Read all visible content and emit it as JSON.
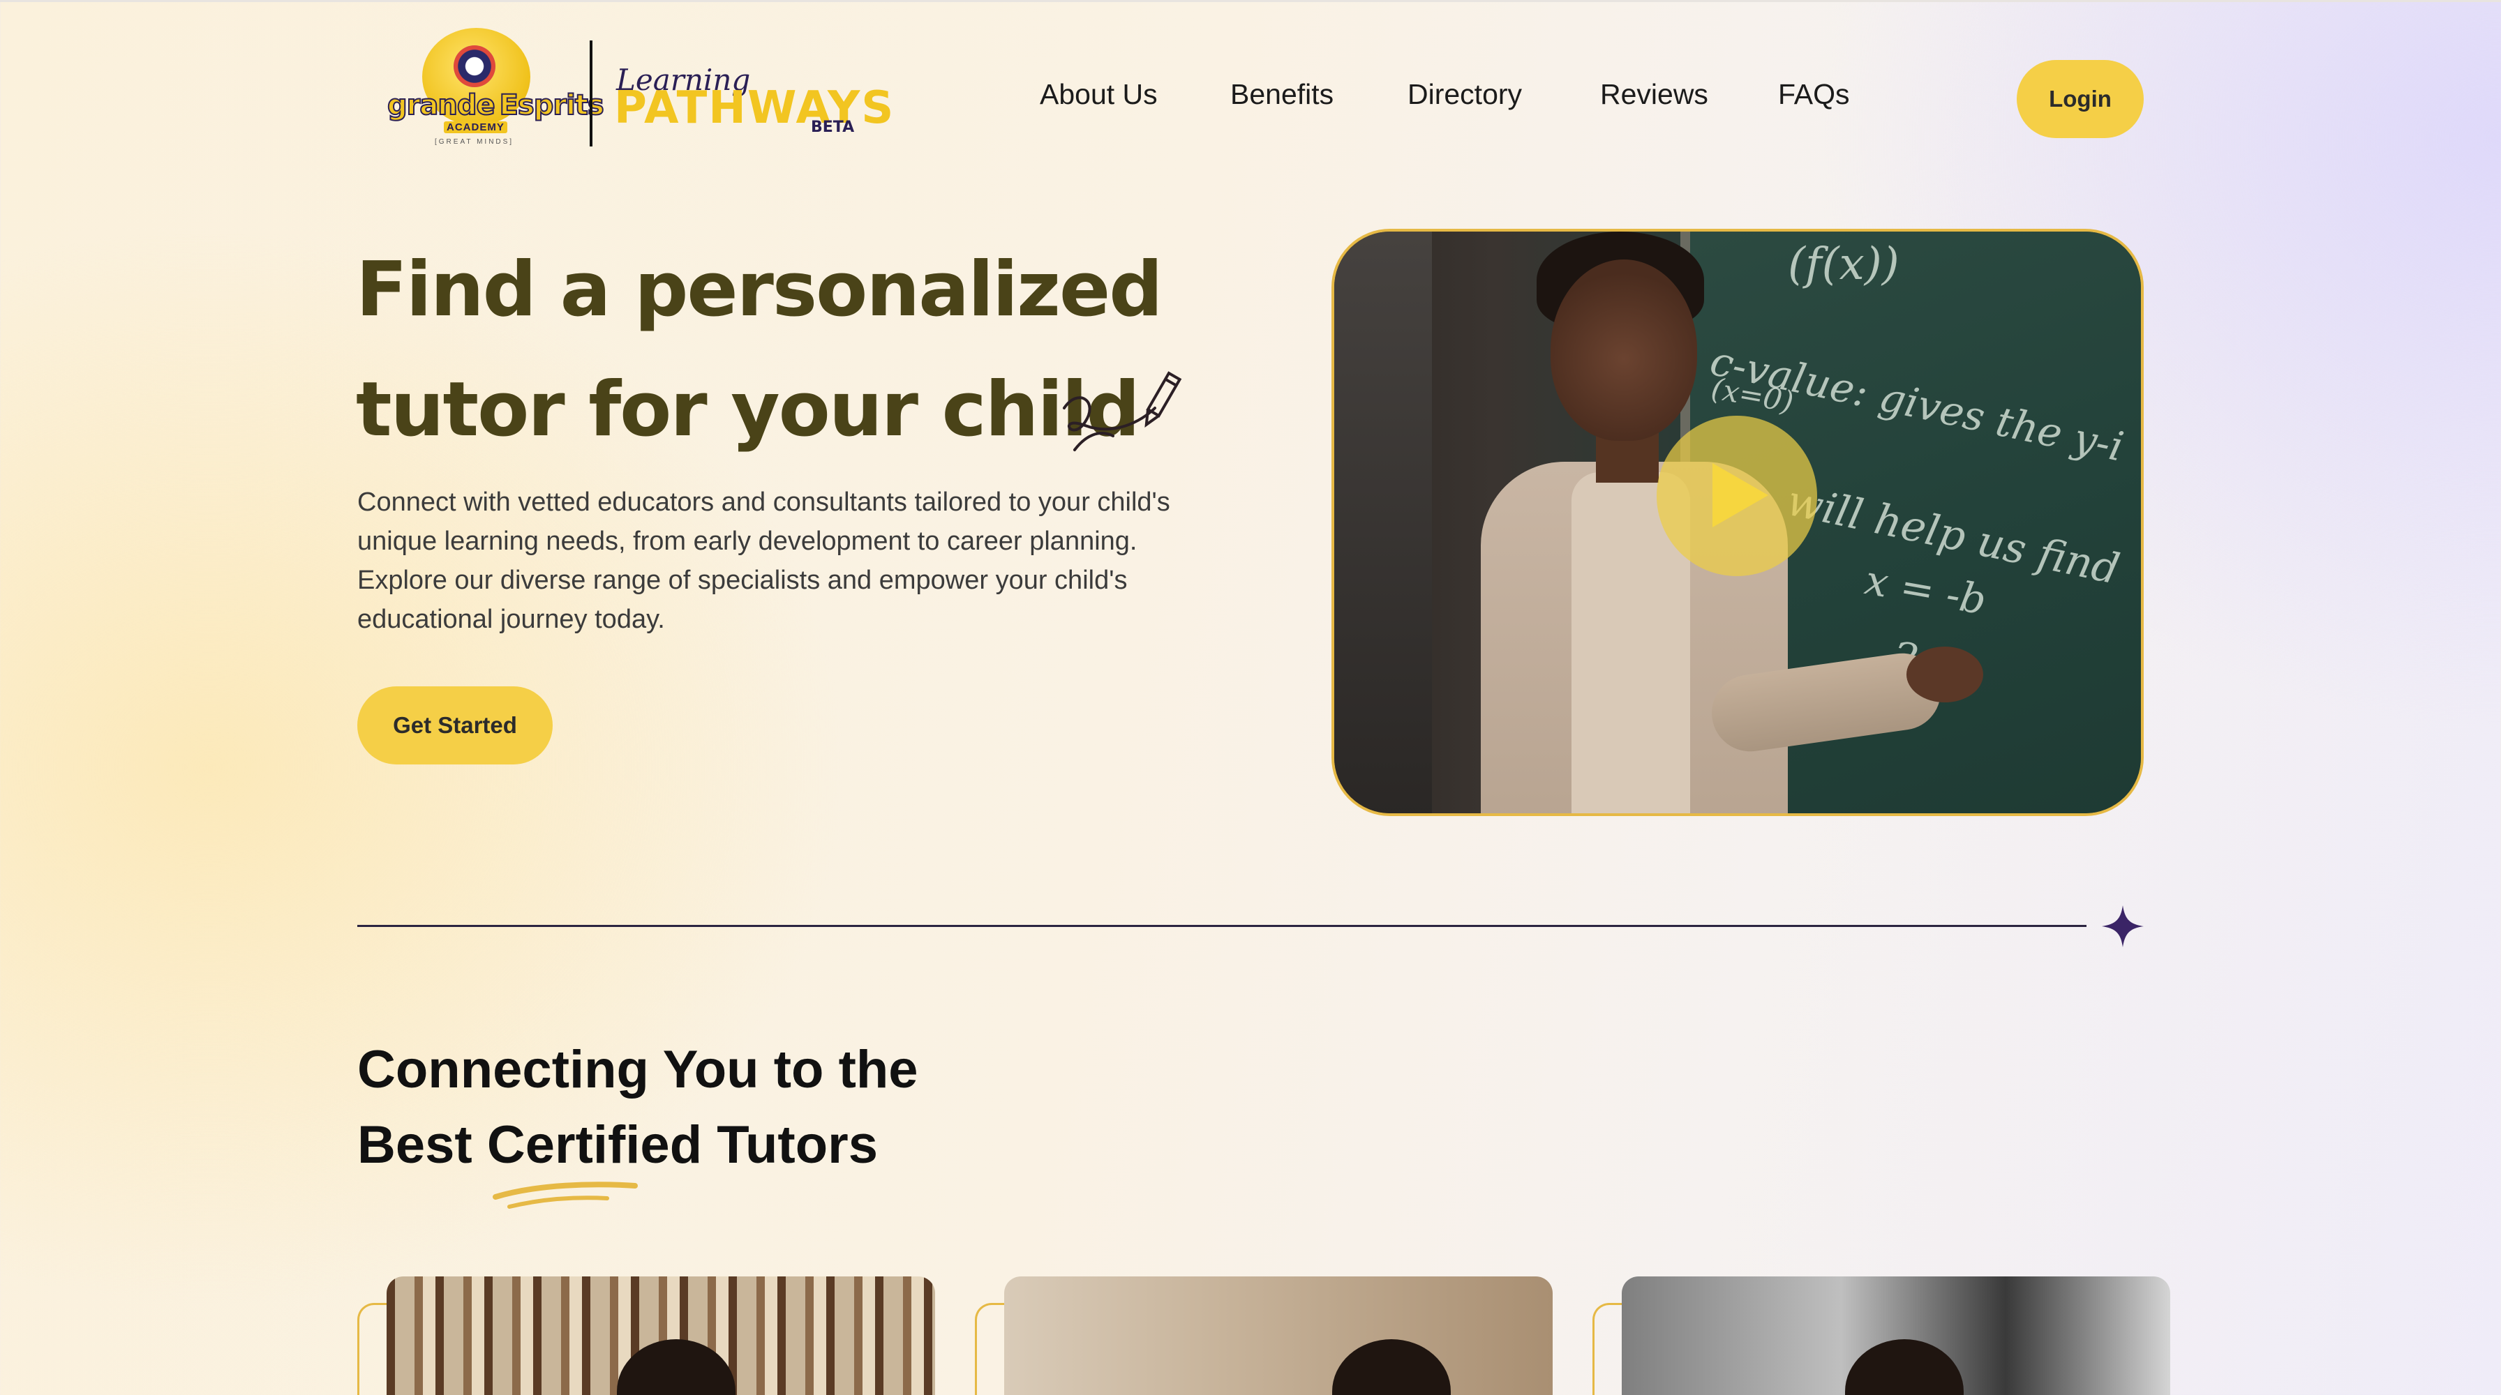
{
  "brand": {
    "academy_name_1": "grande",
    "academy_name_2": "Esprits",
    "academy_sub": "ACADEMY",
    "academy_tagline": "[GREAT MINDS]",
    "product_script": "Learning",
    "product_name": "PATHWAYS",
    "product_badge": "BETA"
  },
  "nav": {
    "items": [
      {
        "label": "About Us"
      },
      {
        "label": "Benefits"
      },
      {
        "label": "Directory"
      },
      {
        "label": "Reviews"
      },
      {
        "label": "FAQs"
      }
    ],
    "login_label": "Login"
  },
  "hero": {
    "title_line1": "Find a personalized",
    "title_line2": "tutor for your child",
    "description": "Connect with vetted educators and consultants tailored to your child's unique learning needs, from early development to career planning. Explore our diverse range of specialists and empower your child's educational journey today.",
    "cta_label": "Get Started",
    "video": {
      "play_icon": "play-icon",
      "chalk_1": "(f(x))",
      "chalk_2": "c-value: gives the y-i",
      "chalk_3": "(x=0)",
      "chalk_4": "will help us find",
      "chalk_5": "x = -b",
      "chalk_6": "2a"
    }
  },
  "divider": {
    "icon": "sparkle-star-icon"
  },
  "section": {
    "title_line1": "Connecting You to the",
    "title_line2": "Best Certified Tutors"
  },
  "tutors": [
    {
      "image": "tutor-photo-1"
    },
    {
      "image": "tutor-photo-2"
    },
    {
      "image": "tutor-photo-3"
    }
  ],
  "colors": {
    "accent_yellow": "#f5cf47",
    "title_olive": "#4a4318",
    "divider_purple": "#2b2440",
    "video_border": "#e6b945"
  }
}
